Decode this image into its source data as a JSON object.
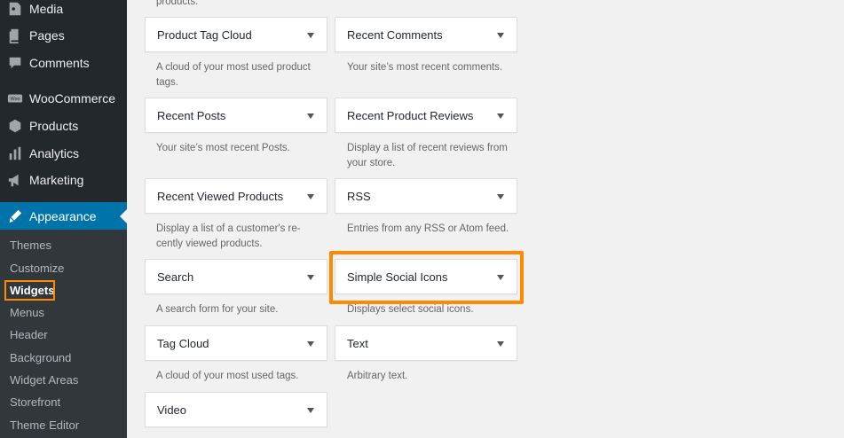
{
  "sidebar": {
    "menu": [
      {
        "label": "Media",
        "icon": "media-icon"
      },
      {
        "label": "Pages",
        "icon": "pages-icon"
      },
      {
        "label": "Comments",
        "icon": "comments-icon"
      },
      {
        "label": "WooCommerce",
        "icon": "woocommerce-icon"
      },
      {
        "label": "Products",
        "icon": "products-icon"
      },
      {
        "label": "Analytics",
        "icon": "analytics-icon"
      },
      {
        "label": "Marketing",
        "icon": "marketing-icon"
      },
      {
        "label": "Appearance",
        "icon": "appearance-icon"
      }
    ],
    "submenu": [
      {
        "label": "Themes"
      },
      {
        "label": "Customize"
      },
      {
        "label": "Widgets"
      },
      {
        "label": "Menus"
      },
      {
        "label": "Header"
      },
      {
        "label": "Background"
      },
      {
        "label": "Widget Areas"
      },
      {
        "label": "Storefront"
      },
      {
        "label": "Theme Editor"
      }
    ]
  },
  "widgets": {
    "top_fragment": "products.",
    "items": [
      {
        "title": "Product Tag Cloud",
        "desc": "A cloud of your most used product tags."
      },
      {
        "title": "Recent Comments",
        "desc": "Your site’s most recent comments."
      },
      {
        "title": "Recent Posts",
        "desc": "Your site’s most recent Posts."
      },
      {
        "title": "Recent Product Reviews",
        "desc": "Display a list of recent reviews from your store."
      },
      {
        "title": "Recent Viewed Products",
        "desc": "Display a list of a customer's re-cently viewed products."
      },
      {
        "title": "RSS",
        "desc": "Entries from any RSS or Atom feed."
      },
      {
        "title": "Search",
        "desc": "A search form for your site."
      },
      {
        "title": "Simple Social Icons",
        "desc": "Displays select social icons."
      },
      {
        "title": "Tag Cloud",
        "desc": "A cloud of your most used tags."
      },
      {
        "title": "Text",
        "desc": "Arbitrary text."
      },
      {
        "title": "Video",
        "desc": ""
      }
    ]
  },
  "colors": {
    "sidebar_bg": "#23282d",
    "submenu_bg": "#32373c",
    "active_bg": "#0073aa",
    "highlight": "#ff8a00"
  }
}
